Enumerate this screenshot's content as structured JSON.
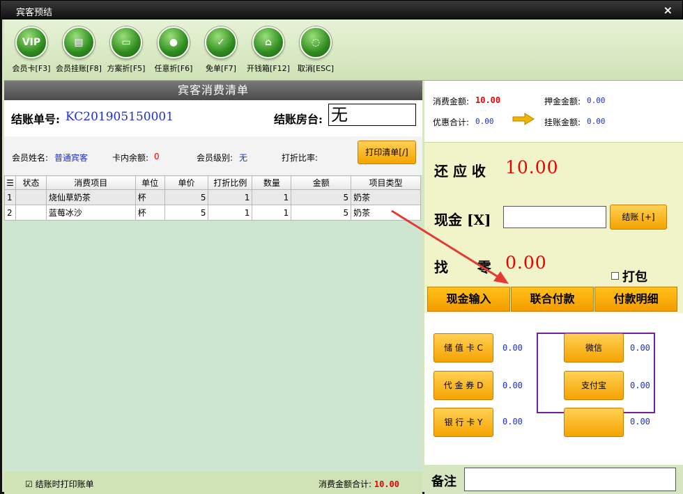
{
  "window": {
    "title": "宾客预结",
    "close_label": "×"
  },
  "toolbar": [
    {
      "label": "会员卡[F3]",
      "icon": "vip-card-icon",
      "glyph": "VIP"
    },
    {
      "label": "会员挂账[F8]",
      "icon": "member-credit-icon",
      "glyph": "▤"
    },
    {
      "label": "方案折[F5]",
      "icon": "scheme-discount-icon",
      "glyph": "▭"
    },
    {
      "label": "任意折[F6]",
      "icon": "any-discount-icon",
      "glyph": "●"
    },
    {
      "label": "免单[F7]",
      "icon": "free-order-icon",
      "glyph": "✓"
    },
    {
      "label": "开钱箱[F12]",
      "icon": "cash-drawer-icon",
      "glyph": "⌂"
    },
    {
      "label": "取消[ESC]",
      "icon": "cancel-icon",
      "glyph": "◌"
    }
  ],
  "list": {
    "title": "宾客消费清单",
    "order_label": "结账单号:",
    "order_no": "KC201905150001",
    "room_label": "结账房台:",
    "room_value": "无"
  },
  "member": {
    "name_label": "会员姓名:",
    "name_value": "普通宾客",
    "balance_label": "卡内余额:",
    "balance_value": "0",
    "level_label": "会员级别:",
    "level_value": "无",
    "discount_label": "打折比率:",
    "print_list_button": "打印清单[/]"
  },
  "table": {
    "corner_icon": "list-icon",
    "headers": [
      "状态",
      "消费项目",
      "单位",
      "单价",
      "打折比例",
      "数量",
      "金额",
      "项目类型"
    ],
    "rows": [
      {
        "idx": "1",
        "status": "",
        "item": "烧仙草奶茶",
        "unit": "杯",
        "price": "5",
        "discount": "1",
        "qty": "1",
        "amount": "5",
        "type": "奶茶"
      },
      {
        "idx": "2",
        "status": "",
        "item": "蓝莓冰沙",
        "unit": "杯",
        "price": "5",
        "discount": "1",
        "qty": "1",
        "amount": "5",
        "type": "奶茶"
      }
    ]
  },
  "footer": {
    "print_on_settle_label": "结账时打印账单",
    "print_on_settle_checked": true,
    "total_label": "消费金额合计:",
    "total_value": "10.00"
  },
  "summary": {
    "consume_label": "消费金额:",
    "consume_value": "10.00",
    "deposit_label": "押金金额:",
    "deposit_value": "0.00",
    "discount_label": "优惠合计:",
    "discount_value": "0.00",
    "credit_label": "挂账金额:",
    "credit_value": "0.00"
  },
  "settle": {
    "due_label": "还 应 收",
    "due_value": "10.00",
    "cash_label": "现金 [X]",
    "settle_button": "结账 [+]",
    "change_label": "找      零",
    "change_value": "0.00",
    "pack_label": "打包"
  },
  "tabs": [
    "现金输入",
    "联合付款",
    "付款明细"
  ],
  "payments": {
    "stored_card": {
      "label": "储 值 卡 C",
      "amount": "0.00"
    },
    "voucher": {
      "label": "代 金 券 D",
      "amount": "0.00"
    },
    "bank_card": {
      "label": "银 行 卡 Y",
      "amount": "0.00"
    },
    "wechat": {
      "label": "微信",
      "amount": "0.00"
    },
    "alipay": {
      "label": "支付宝",
      "amount": "0.00"
    },
    "blank": {
      "label": "",
      "amount": "0.00"
    }
  },
  "remark": {
    "label": "备注",
    "value": ""
  },
  "colors": {
    "accent_orange": "#f5a300",
    "highlight_red": "#e00000",
    "value_blue": "#1a2fd6",
    "annotation_purple": "#7a1fa0"
  }
}
